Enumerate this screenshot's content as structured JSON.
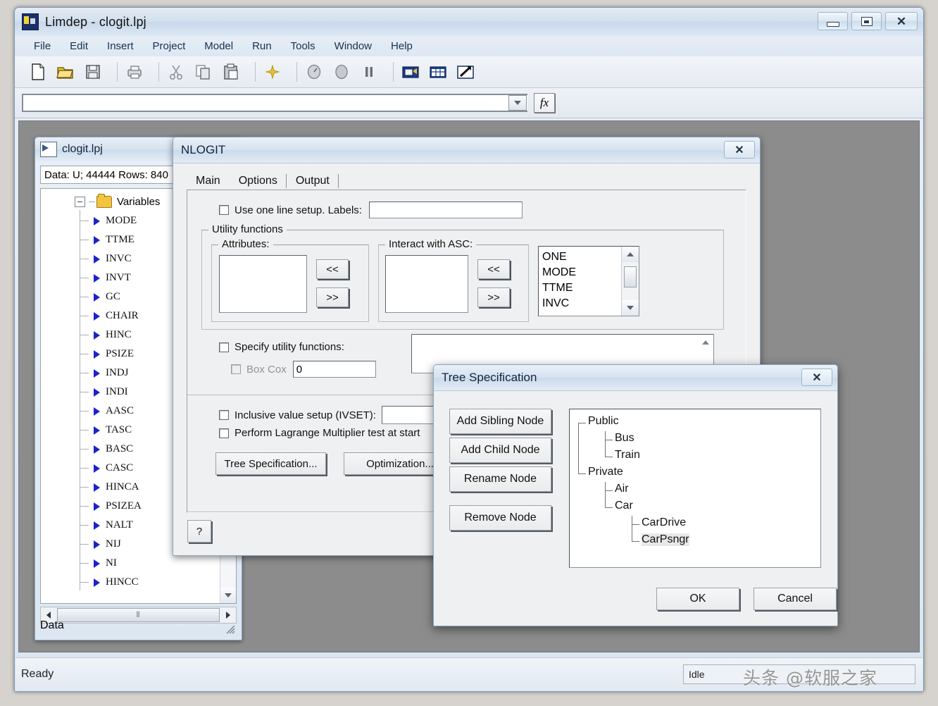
{
  "app": {
    "title": "Limdep - clogit.lpj",
    "icon": "limdep-app-icon",
    "window_buttons": {
      "minimize": "minimize-icon",
      "maximize": "maximize-icon",
      "close": "✕"
    },
    "menu": [
      "File",
      "Edit",
      "Insert",
      "Project",
      "Model",
      "Run",
      "Tools",
      "Window",
      "Help"
    ],
    "toolbar": [
      {
        "name": "new-file-icon",
        "group": 0
      },
      {
        "name": "open-folder-icon",
        "group": 0
      },
      {
        "name": "save-icon",
        "group": 0
      },
      {
        "name": "print-icon",
        "group": 1
      },
      {
        "name": "cut-icon",
        "group": 2
      },
      {
        "name": "copy-icon",
        "group": 2
      },
      {
        "name": "paste-icon",
        "group": 2
      },
      {
        "name": "sparkle-icon",
        "group": 3
      },
      {
        "name": "go-icon",
        "group": 4
      },
      {
        "name": "stop-icon",
        "group": 4
      },
      {
        "name": "pause-icon",
        "group": 4
      },
      {
        "name": "project-icon",
        "group": 5
      },
      {
        "name": "matrix-icon",
        "group": 5
      },
      {
        "name": "tools-icon",
        "group": 5
      }
    ],
    "formula_bar": {
      "value": "",
      "placeholder": "",
      "fx_label": "fx"
    },
    "status": {
      "left": "Ready",
      "right": "Idle",
      "watermark": "头条 @软服之家"
    }
  },
  "data_window": {
    "title": "clogit.lpj",
    "icon": "data-window-icon",
    "buttons": {
      "minimize": "minimize-icon",
      "maximize": "maximize-icon"
    },
    "data_info": "Data: U; 44444 Rows: 840",
    "tree_root": "Variables",
    "expander": "−",
    "variables": [
      "MODE",
      "TTME",
      "INVC",
      "INVT",
      "GC",
      "CHAIR",
      "HINC",
      "PSIZE",
      "INDJ",
      "INDI",
      "AASC",
      "TASC",
      "BASC",
      "CASC",
      "HINCA",
      "PSIZEA",
      "NALT",
      "NIJ",
      "NI",
      "HINCC"
    ],
    "footer_label": "Data",
    "hscroll_grip": "⦀"
  },
  "nlogit": {
    "title": "NLOGIT",
    "close_glyph": "✕",
    "tabs": [
      {
        "label": "Main",
        "selected": false
      },
      {
        "label": "Options",
        "selected": true
      },
      {
        "label": "Output",
        "selected": false
      }
    ],
    "one_line_setup": {
      "label": "Use one line setup. Labels:",
      "checked": false,
      "value": ""
    },
    "utility_functions": {
      "title": "Utility functions",
      "attributes": {
        "title": "Attributes:",
        "items": [],
        "btn_add": "<<",
        "btn_remove": ">>"
      },
      "interact_asc": {
        "title": "Interact with ASC:",
        "items": [],
        "btn_add": "<<",
        "btn_remove": ">>"
      },
      "variable_list": [
        "ONE",
        "MODE",
        "TTME",
        "INVC"
      ]
    },
    "specify_utility": {
      "label": "Specify utility functions:",
      "checked": false,
      "value": ""
    },
    "box_cox": {
      "label": "Box Cox",
      "checked": false,
      "value": "0",
      "disabled": true
    },
    "ivset": {
      "label": "Inclusive value setup (IVSET):",
      "checked": false,
      "value": ""
    },
    "lagrange": {
      "label": "Perform Lagrange Multiplier test at start",
      "checked": false
    },
    "buttons": {
      "tree_specification": "Tree Specification...",
      "optimization": "Optimization...",
      "help": "?"
    }
  },
  "tree_specification": {
    "title": "Tree Specification",
    "close_glyph": "✕",
    "buttons": {
      "add_sibling": "Add Sibling Node",
      "add_child": "Add Child Node",
      "rename": "Rename Node",
      "remove": "Remove Node",
      "ok": "OK",
      "cancel": "Cancel"
    },
    "tree": [
      {
        "label": "Public",
        "depth": 0,
        "selected": false
      },
      {
        "label": "Bus",
        "depth": 1,
        "selected": false
      },
      {
        "label": "Train",
        "depth": 1,
        "selected": false
      },
      {
        "label": "Private",
        "depth": 0,
        "selected": false
      },
      {
        "label": "Air",
        "depth": 1,
        "selected": false
      },
      {
        "label": "Car",
        "depth": 1,
        "selected": false
      },
      {
        "label": "CarDrive",
        "depth": 2,
        "selected": false
      },
      {
        "label": "CarPsngr",
        "depth": 2,
        "selected": true
      }
    ]
  }
}
